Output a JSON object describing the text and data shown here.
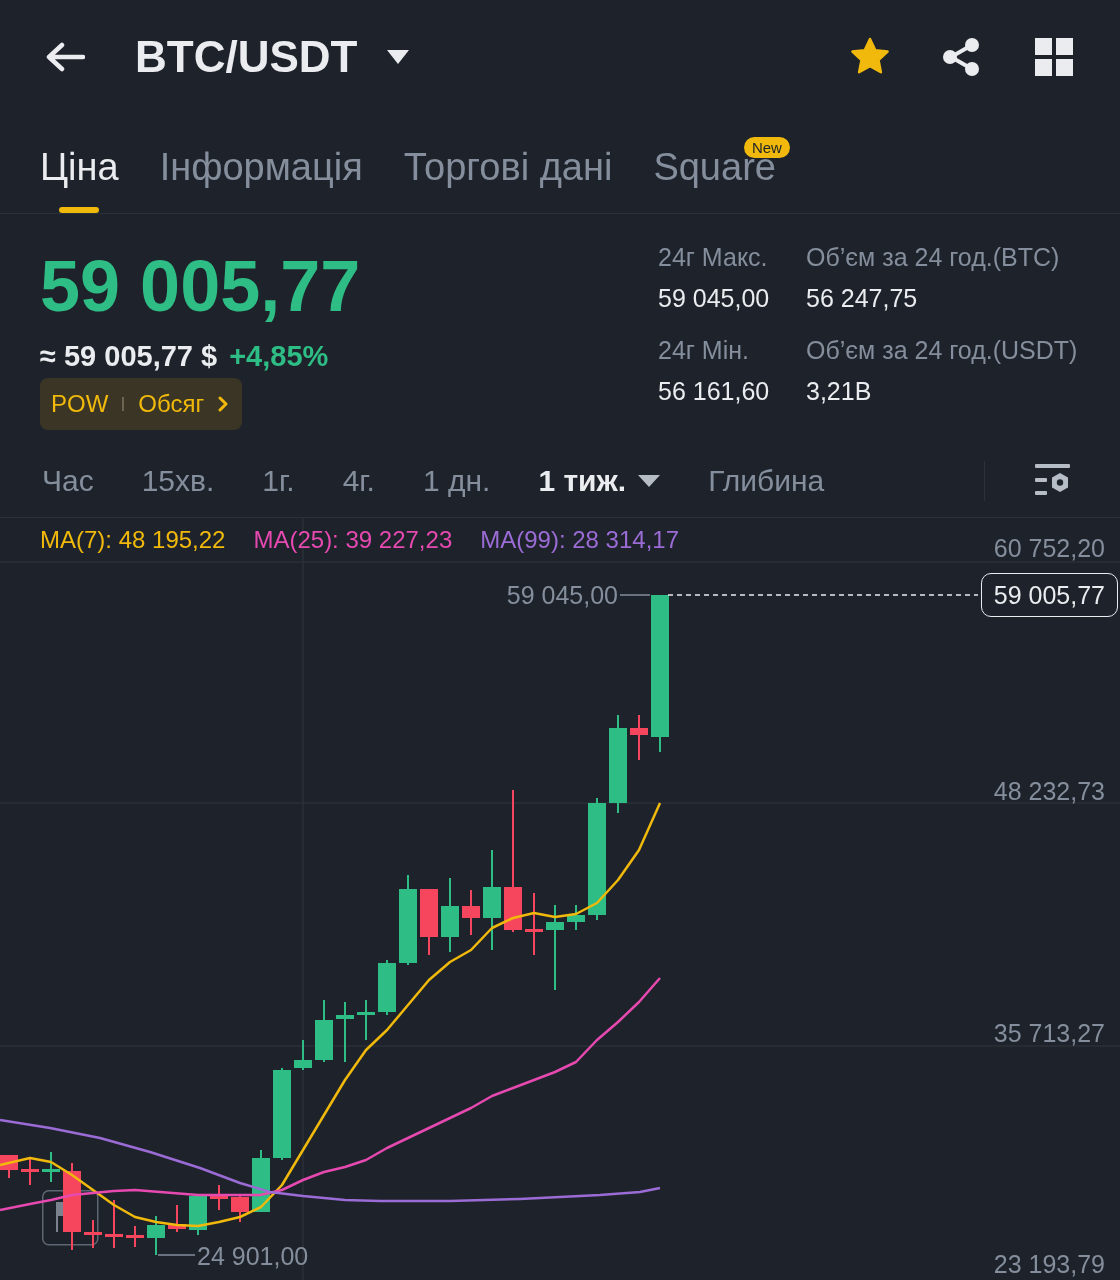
{
  "header": {
    "title": "BTC/USDT",
    "favorite": true
  },
  "tabs": [
    {
      "label": "Ціна",
      "selected": true
    },
    {
      "label": "Інформація",
      "selected": false
    },
    {
      "label": "Торгові дані",
      "selected": false
    },
    {
      "label": "Square",
      "selected": false,
      "badge": "New"
    }
  ],
  "price": {
    "last": "59 005,77",
    "approx": "≈ 59 005,77 $",
    "change": "+4,85%",
    "rising": true,
    "tags": [
      "POW",
      "Обсяг"
    ]
  },
  "stats": [
    {
      "label": "24г Макс.",
      "value": "59 045,00"
    },
    {
      "label": "Об’єм за 24 год.(BTC)",
      "value": "56 247,75"
    },
    {
      "label": "24г Мін.",
      "value": "56 161,60"
    },
    {
      "label": "Об’єм за 24 год.(USDT)",
      "value": "3,21B"
    }
  ],
  "intervals": [
    {
      "label": "Час",
      "selected": false,
      "menu": false
    },
    {
      "label": "15хв.",
      "selected": false,
      "menu": false
    },
    {
      "label": "1г.",
      "selected": false,
      "menu": false
    },
    {
      "label": "4г.",
      "selected": false,
      "menu": false
    },
    {
      "label": "1 дн.",
      "selected": false,
      "menu": false
    },
    {
      "label": "1 тиж.",
      "selected": true,
      "menu": true
    },
    {
      "label": "Глибина",
      "selected": false,
      "menu": false
    }
  ],
  "chart": {
    "ma_legend": [
      {
        "label": "MA(7): 48 195,22",
        "color": "#f0b90b"
      },
      {
        "label": "MA(25): 39 227,23",
        "color": "#e649b0"
      },
      {
        "label": "MA(99): 28 314,17",
        "color": "#9b6bd6"
      }
    ],
    "price_axis": [
      "60 752,20",
      "48 232,73",
      "35 713,27",
      "23 193,79"
    ],
    "high_label": "59 045,00",
    "low_label": "24 901,00",
    "last_price": "59 005,77"
  }
}
